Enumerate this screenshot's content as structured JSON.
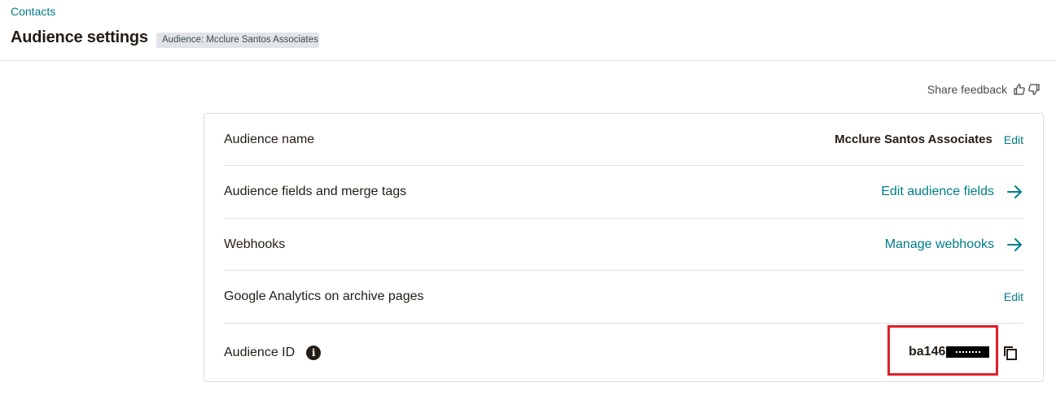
{
  "header": {
    "breadcrumb": "Contacts",
    "title": "Audience settings",
    "audience_badge": "Audience: Mcclure Santos Associates"
  },
  "feedback": {
    "label": "Share feedback",
    "thumbs_up_icon": "thumbs-up-icon",
    "thumbs_down_icon": "thumbs-down-icon"
  },
  "settings": {
    "audience_name": {
      "label": "Audience name",
      "value": "Mcclure Santos Associates",
      "edit": "Edit"
    },
    "fields": {
      "label": "Audience fields and merge tags",
      "link": "Edit audience fields"
    },
    "webhooks": {
      "label": "Webhooks",
      "link": "Manage webhooks"
    },
    "analytics": {
      "label": "Google Analytics on archive pages",
      "edit": "Edit"
    },
    "audience_id": {
      "label": "Audience ID",
      "value": "ba146",
      "info_icon": "i"
    }
  },
  "colors": {
    "accent": "#007c89",
    "text": "#241c15",
    "highlight": "#e0202a",
    "badge_bg": "#e1e5e9"
  }
}
